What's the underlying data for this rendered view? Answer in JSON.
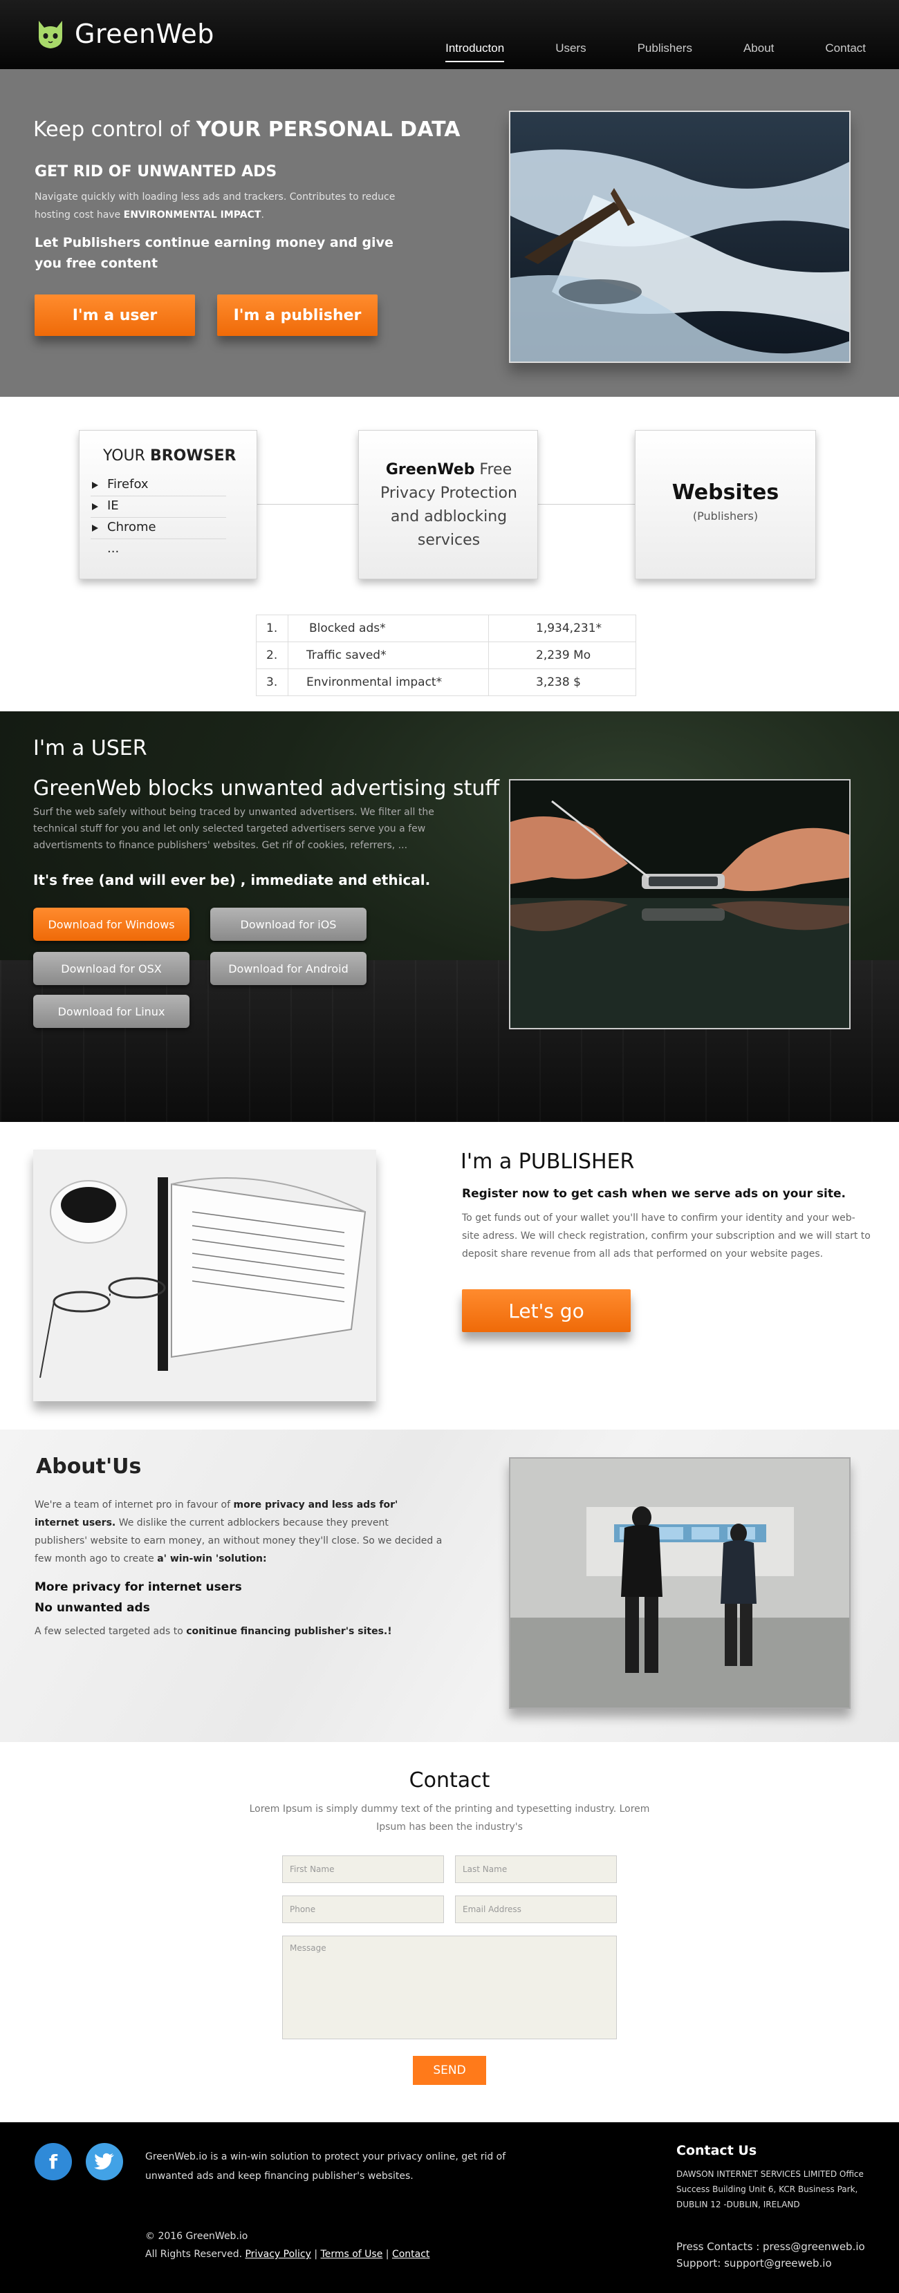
{
  "header": {
    "brand": "GreenWeb",
    "nav": [
      "Introducton",
      "Users",
      "Publishers",
      "About",
      "Contact"
    ]
  },
  "hero": {
    "title_prefix": "Keep control of ",
    "title_strong": "YOUR PERSONAL DATA",
    "subtitle": "GET RID OF UNWANTED ADS",
    "description": "Navigate quickly with loading less ads and trackers. Contributes to reduce hosting cost have ",
    "description_strong": "ENVIRONMENTAL IMPACT",
    "description_end": ".",
    "publishers_line": "Let Publishers continue earning money and give you free content",
    "btn_user": "I'm a user",
    "btn_publisher": "I'm a publisher"
  },
  "diagram": {
    "browser_title_prefix": "YOUR ",
    "browser_title_strong": "BROWSER",
    "browsers": [
      "Firefox",
      "IE",
      "Chrome",
      "..."
    ],
    "gw_strong": "GreenWeb",
    "gw_text": " Free Privacy Protection and adblocking services",
    "websites_title": "Websites",
    "websites_sub": "(Publishers)"
  },
  "stats": [
    {
      "num": "1.",
      "label": "Blocked ads*",
      "value": "1,934,231*"
    },
    {
      "num": "2.",
      "label": "Traffic saved*",
      "value": "2,239 Mo"
    },
    {
      "num": "3.",
      "label": "Environmental impact*",
      "value": "3,238 $"
    }
  ],
  "users": {
    "title": "I'm a USER",
    "subtitle": "GreenWeb blocks unwanted advertising stuff",
    "description": "Surf the web safely  without  being  traced by unwanted  advertisers. We filter all the technical  stuff for you and let only selected  targeted  advertisers serve you a few advertisments to finance publishers' websites. Get rif of cookies, referrers, ...",
    "free": "It's free  (and will ever be) , immediate and ethical.",
    "downloads": {
      "windows": "Download for Windows",
      "ios": "Download for iOS",
      "osx": "Download for OSX",
      "android": "Download for Android",
      "linux": "Download for Linux"
    }
  },
  "publisher": {
    "title": "I'm a PUBLISHER",
    "register": "Register now to get cash when we serve ads on your site.",
    "description": "To get funds out of your wallet  you'll have to confirm your identity and your web-site adress. We will check registration, confirm your subscription and we will start to deposit share revenue from all ads that performed on your website pages.",
    "button": "Let's go"
  },
  "about": {
    "title": "About'Us",
    "p1_a": "We're a team of internet pro in favour of ",
    "p1_b": "more privacy and less ads for' internet users.",
    "p1_c": " We  dislike the current adblockers because they prevent publishers' website to earn money, an without money they'll close. So we decided a few month ago to create ",
    "p1_d": "a' win-win 'solution:",
    "line1": "More privacy for internet users",
    "line2": "No unwanted ads",
    "few_a": "A few selected targeted ads to ",
    "few_b": "conitinue financing publisher's sites.!"
  },
  "contact": {
    "title": "Contact",
    "description": "Lorem Ipsum is simply dummy text of the printing and typesetting industry. Lorem Ipsum has been the industry's",
    "placeholders": {
      "first": "First Name",
      "last": "Last Name",
      "phone": "Phone",
      "email": "Email Address",
      "message": "Message"
    },
    "send": "SEND"
  },
  "footer": {
    "facebook": "f",
    "twitter": "t",
    "text": "GreenWeb.io is a win-win solution to protect your privacy online, get rid of unwanted ads and keep financing publisher's websites.",
    "copyright": "© 2016 GreenWeb.io",
    "rights": "All Rights Reserved.",
    "privacy": "Privacy Policy",
    "terms": "Terms of Use",
    "contact_link": "Contact",
    "sep": " | ",
    "contact_title": "Contact Us",
    "address": "DAWSON INTERNET SERVICES LIMITED Office Success Building Unit 6, KCR Business Park, DUBLIN 12 -DUBLIN, IRELAND",
    "press": "Press Contacts : press@greenweb.io",
    "support": "Support: support@greeweb.io"
  },
  "colors": {
    "accent": "#f57a1a",
    "header_bg": "#0a0a0a",
    "hero_bg": "#777777",
    "logo_green": "#a8d96a"
  }
}
